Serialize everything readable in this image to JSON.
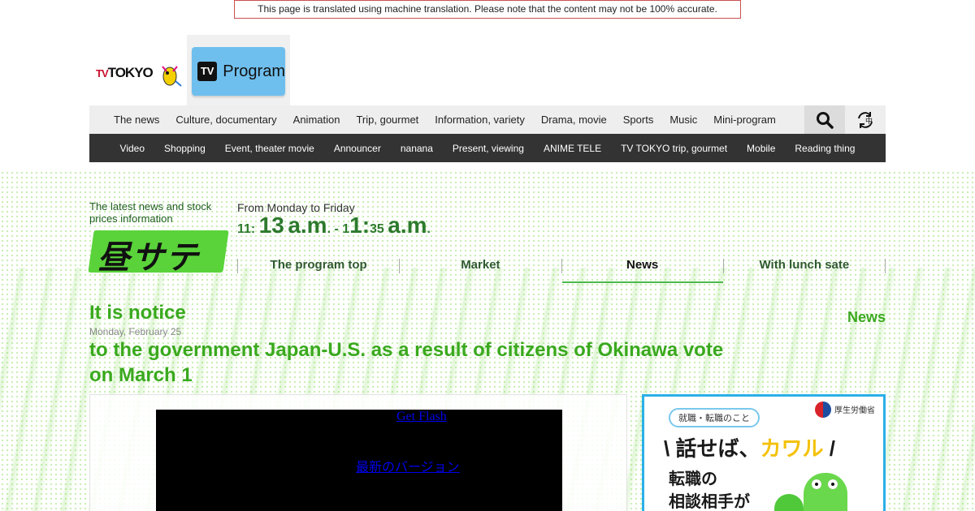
{
  "notice": "This page is translated using machine translation. Please note that the content may not be 100% accurate.",
  "header": {
    "program_label": "Program"
  },
  "nav_primary": [
    "The news",
    "Culture, documentary",
    "Animation",
    "Trip, gourmet",
    "Information, variety",
    "Drama, movie",
    "Sports",
    "Music",
    "Mini-program"
  ],
  "nav_secondary": [
    "Video",
    "Shopping",
    "Event, theater movie",
    "Announcer",
    "nanana",
    "Present, viewing",
    "ANIME TELE",
    "TV TOKYO trip, gourmet",
    "Mobile",
    "Reading thing"
  ],
  "show": {
    "tagline": "The latest news and stock prices information",
    "days": "From Monday to Friday",
    "time_parts": [
      "11:",
      "13",
      "a.m",
      ". - 1",
      "1:",
      "35",
      "a.m",
      "."
    ]
  },
  "subnav": [
    "The program top",
    "Market",
    "News",
    "With lunch sate"
  ],
  "subnav_active": 2,
  "article": {
    "heading": "It is notice",
    "date": "Monday, February 25",
    "title": "to the government Japan-U.S. as a result of citizens of Okinawa vote on March 1",
    "section_label": "News"
  },
  "player": {
    "get_flash": "Get Flash",
    "latest_version": "最新のバージョン"
  },
  "ad": {
    "pill": "就職・転職のこと",
    "ministry": "厚生労働省",
    "headline_a": "\\ 話せば、",
    "headline_b": "カワル",
    "headline_c": " /",
    "line1": "転職の",
    "line2": "相談相手が"
  },
  "colors": {
    "accent_green": "#3aa91e",
    "program_button": "#6fbfee",
    "nav_dark": "#333333"
  }
}
